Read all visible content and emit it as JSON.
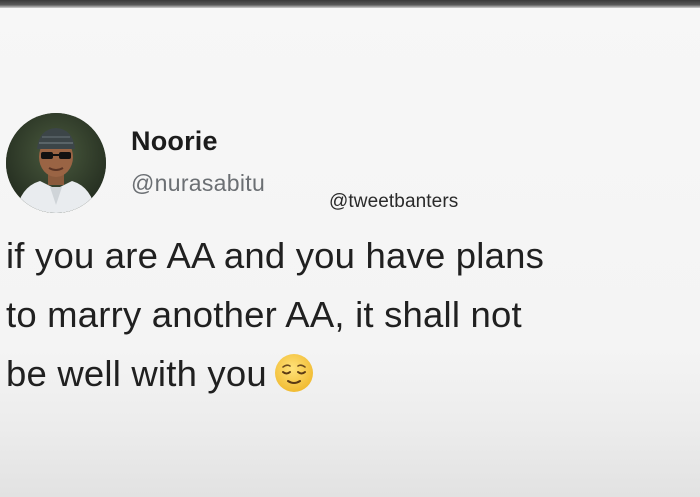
{
  "tweet": {
    "author_name": "Noorie",
    "author_handle": "@nurasabitu",
    "watermark": "@tweetbanters",
    "text_lines": [
      "if you are AA and you have plans",
      "to marry another AA, it shall not",
      "be well with you"
    ],
    "emoji": "relieved-face-icon"
  },
  "colors": {
    "name": "#1c1c1c",
    "handle": "#6b6f73",
    "text": "#202020",
    "emoji_face": "#f5c842"
  }
}
